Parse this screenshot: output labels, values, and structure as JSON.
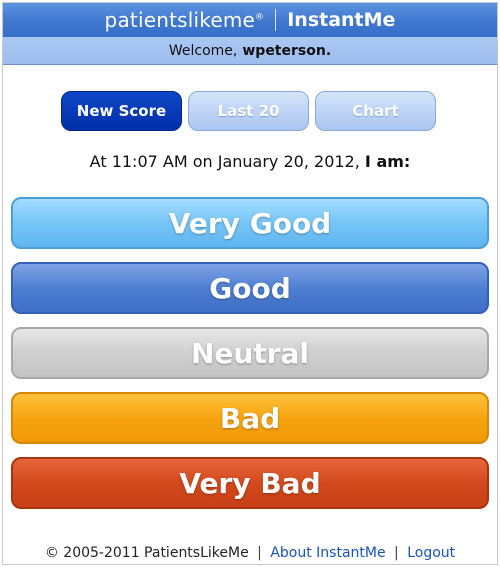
{
  "header": {
    "brand": "patientslikeme",
    "brand_mark": "®",
    "app_name": "InstantMe"
  },
  "welcome": {
    "prefix": "Welcome,",
    "username": "wpeterson."
  },
  "tabs": [
    {
      "label": "New Score",
      "active": true
    },
    {
      "label": "Last 20",
      "active": false
    },
    {
      "label": "Chart",
      "active": false
    }
  ],
  "prompt": {
    "text": "At 11:07 AM on January 20, 2012,",
    "emphasis": "I am:"
  },
  "moods": [
    {
      "label": "Very Good",
      "color": "#76c5f7"
    },
    {
      "label": "Good",
      "color": "#4f7fd2"
    },
    {
      "label": "Neutral",
      "color": "#cfcfcf"
    },
    {
      "label": "Bad",
      "color": "#f7a410"
    },
    {
      "label": "Very Bad",
      "color": "#d24a1d"
    }
  ],
  "footer": {
    "copyright": "© 2005-2011 PatientsLikeMe",
    "about_link": "About InstantMe",
    "logout_link": "Logout",
    "separator": "|"
  }
}
